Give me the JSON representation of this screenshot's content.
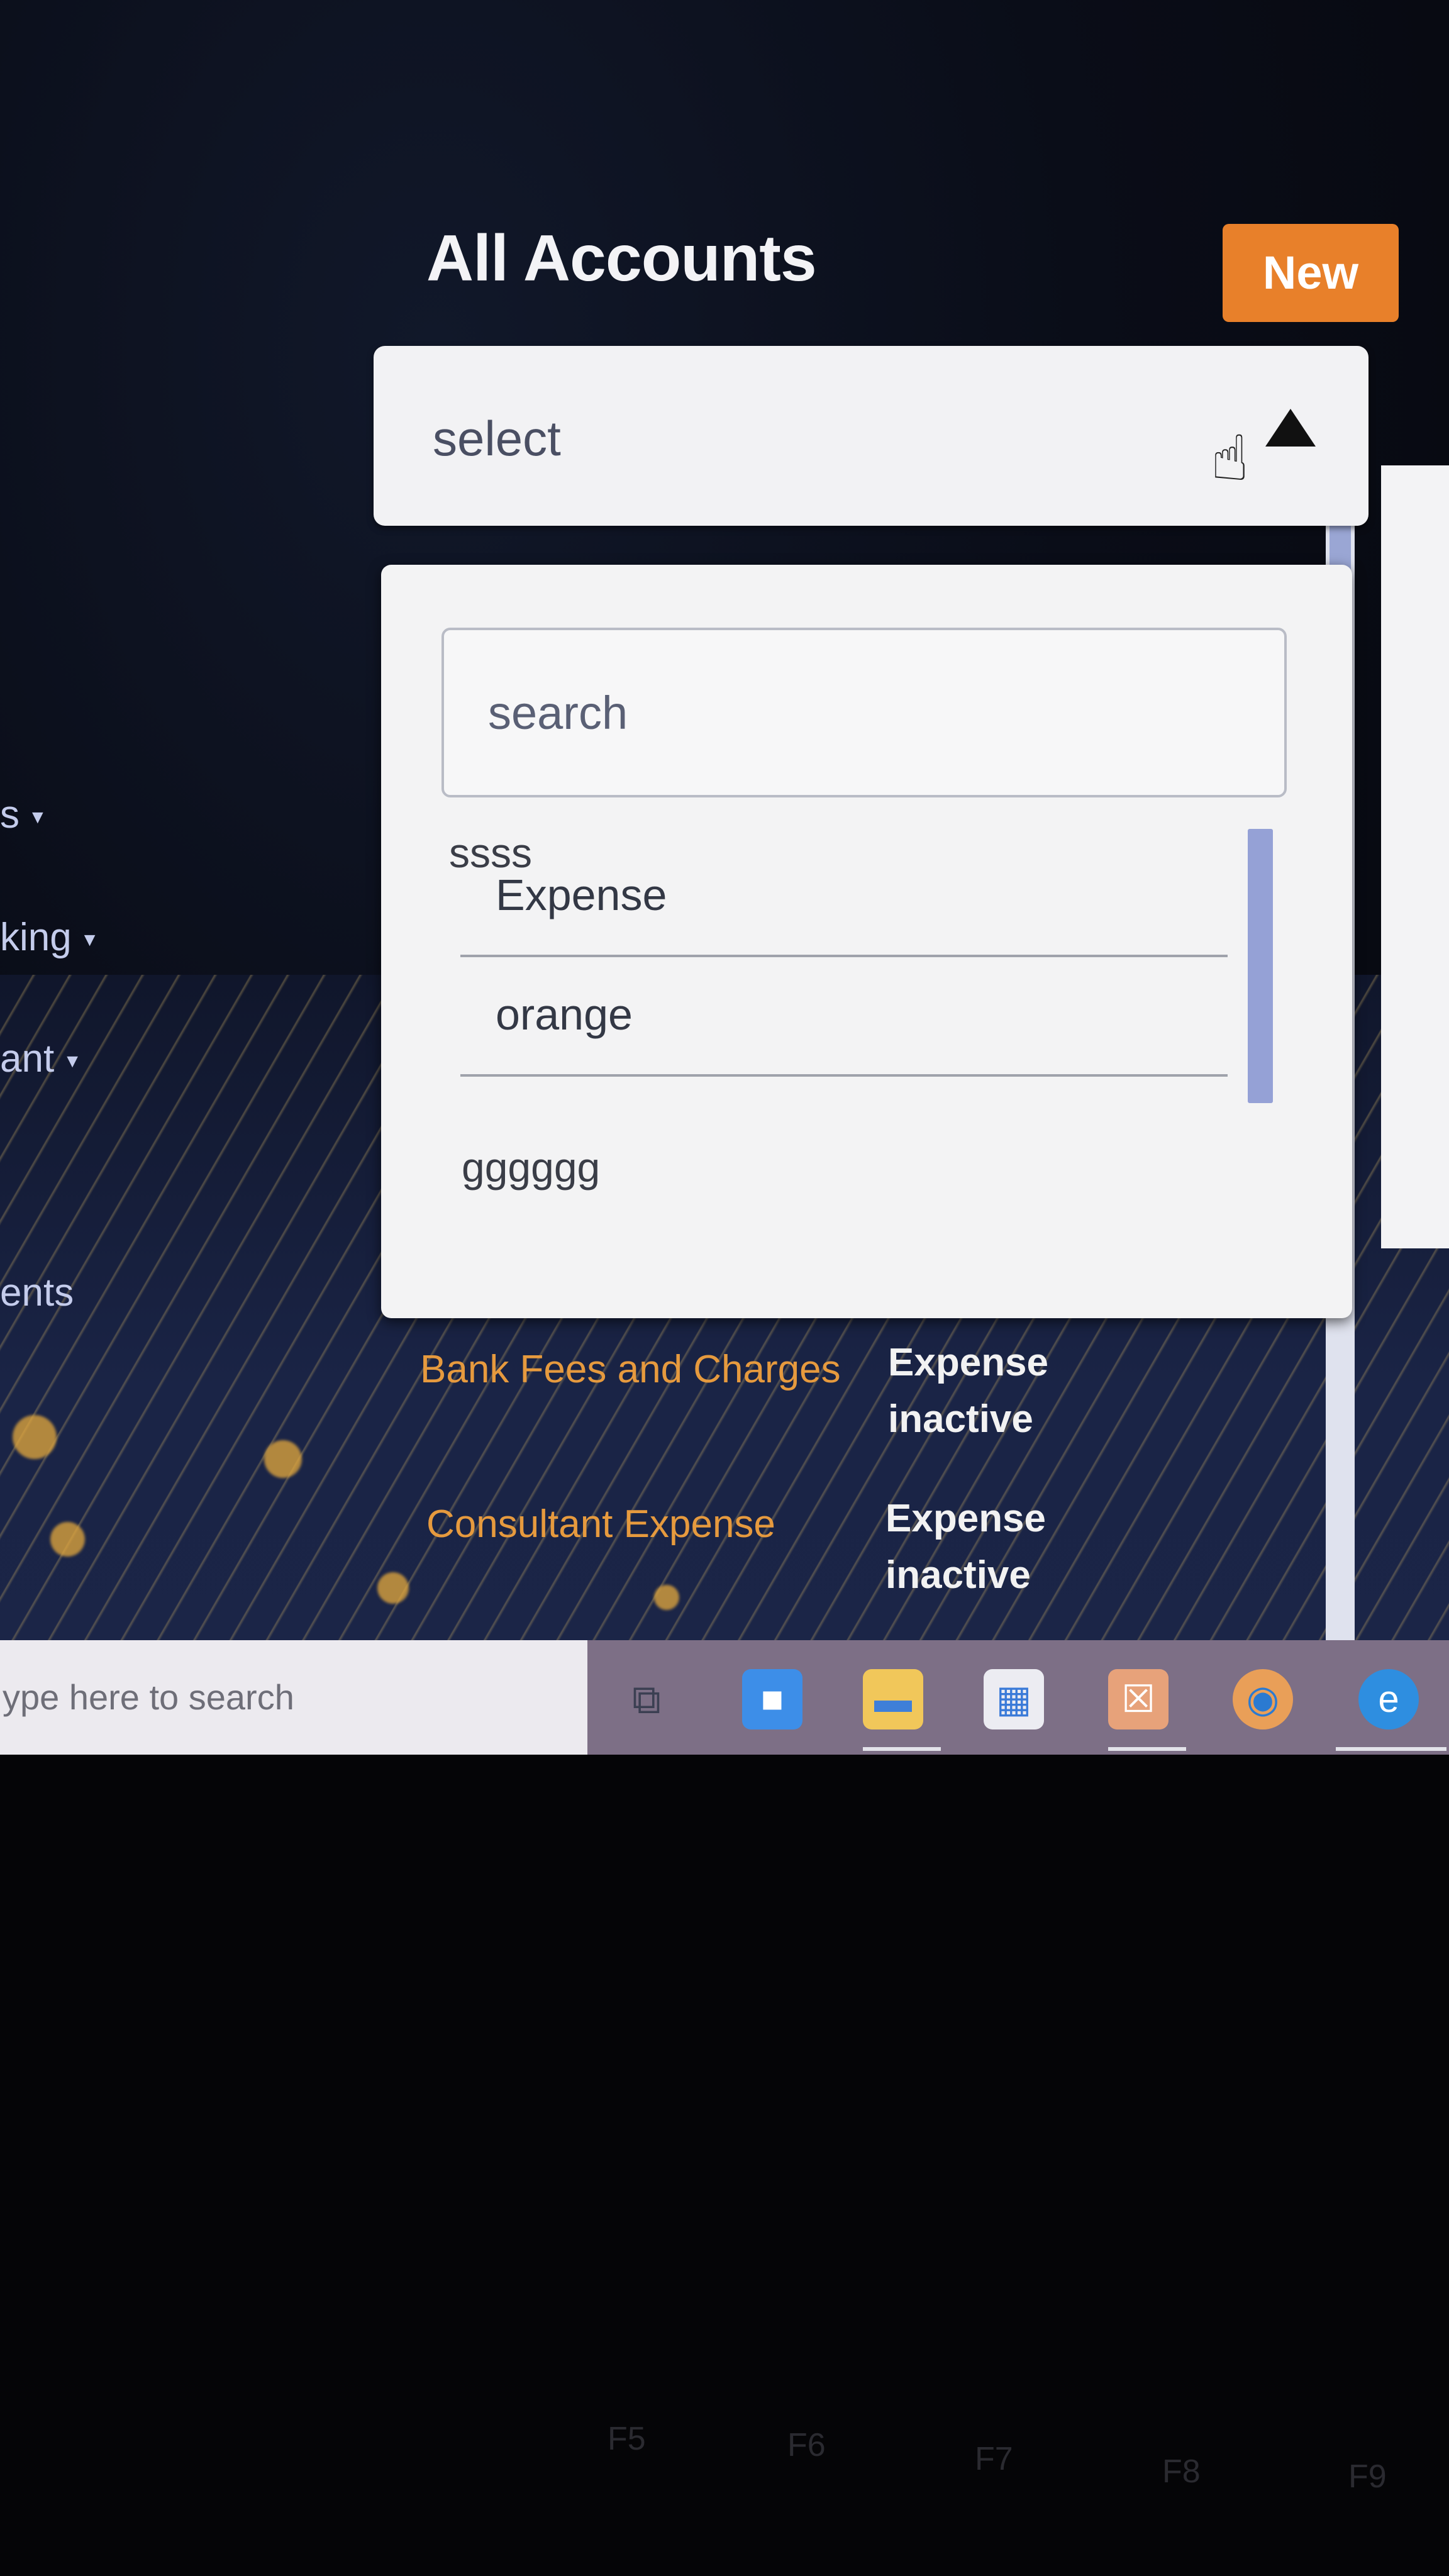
{
  "page": {
    "title": "All Accounts",
    "new_button": "New"
  },
  "sidebar": {
    "items": [
      {
        "label": "s"
      },
      {
        "label": "king"
      },
      {
        "label": "ant"
      },
      {
        "label": "ents"
      }
    ]
  },
  "account_select": {
    "value": "select"
  },
  "dropdown": {
    "search_placeholder": "search",
    "group_label": "ssss",
    "options": [
      {
        "label": "Expense"
      },
      {
        "label": "orange"
      }
    ],
    "group_label_2": "gggggg"
  },
  "accounts": [
    {
      "name": "Bank Fees and Charges",
      "type": "Expense",
      "status": "inactive"
    },
    {
      "name": "Consultant Expense",
      "type": "Expense",
      "status": "inactive"
    }
  ],
  "taskbar": {
    "search_placeholder": "ype here to search",
    "apps": [
      {
        "icon": "task-view-icon"
      },
      {
        "icon": "meet-icon"
      },
      {
        "icon": "file-explorer-icon"
      },
      {
        "icon": "store-icon"
      },
      {
        "icon": "xampp-icon"
      },
      {
        "icon": "chrome-icon"
      },
      {
        "icon": "edge-icon"
      }
    ]
  },
  "keyboard": {
    "keys": [
      "F5",
      "F6",
      "F7",
      "F8",
      "F9"
    ]
  },
  "colors": {
    "accent": "#e8802a",
    "account_name": "#e69a3e",
    "background": "#0a0d18"
  }
}
